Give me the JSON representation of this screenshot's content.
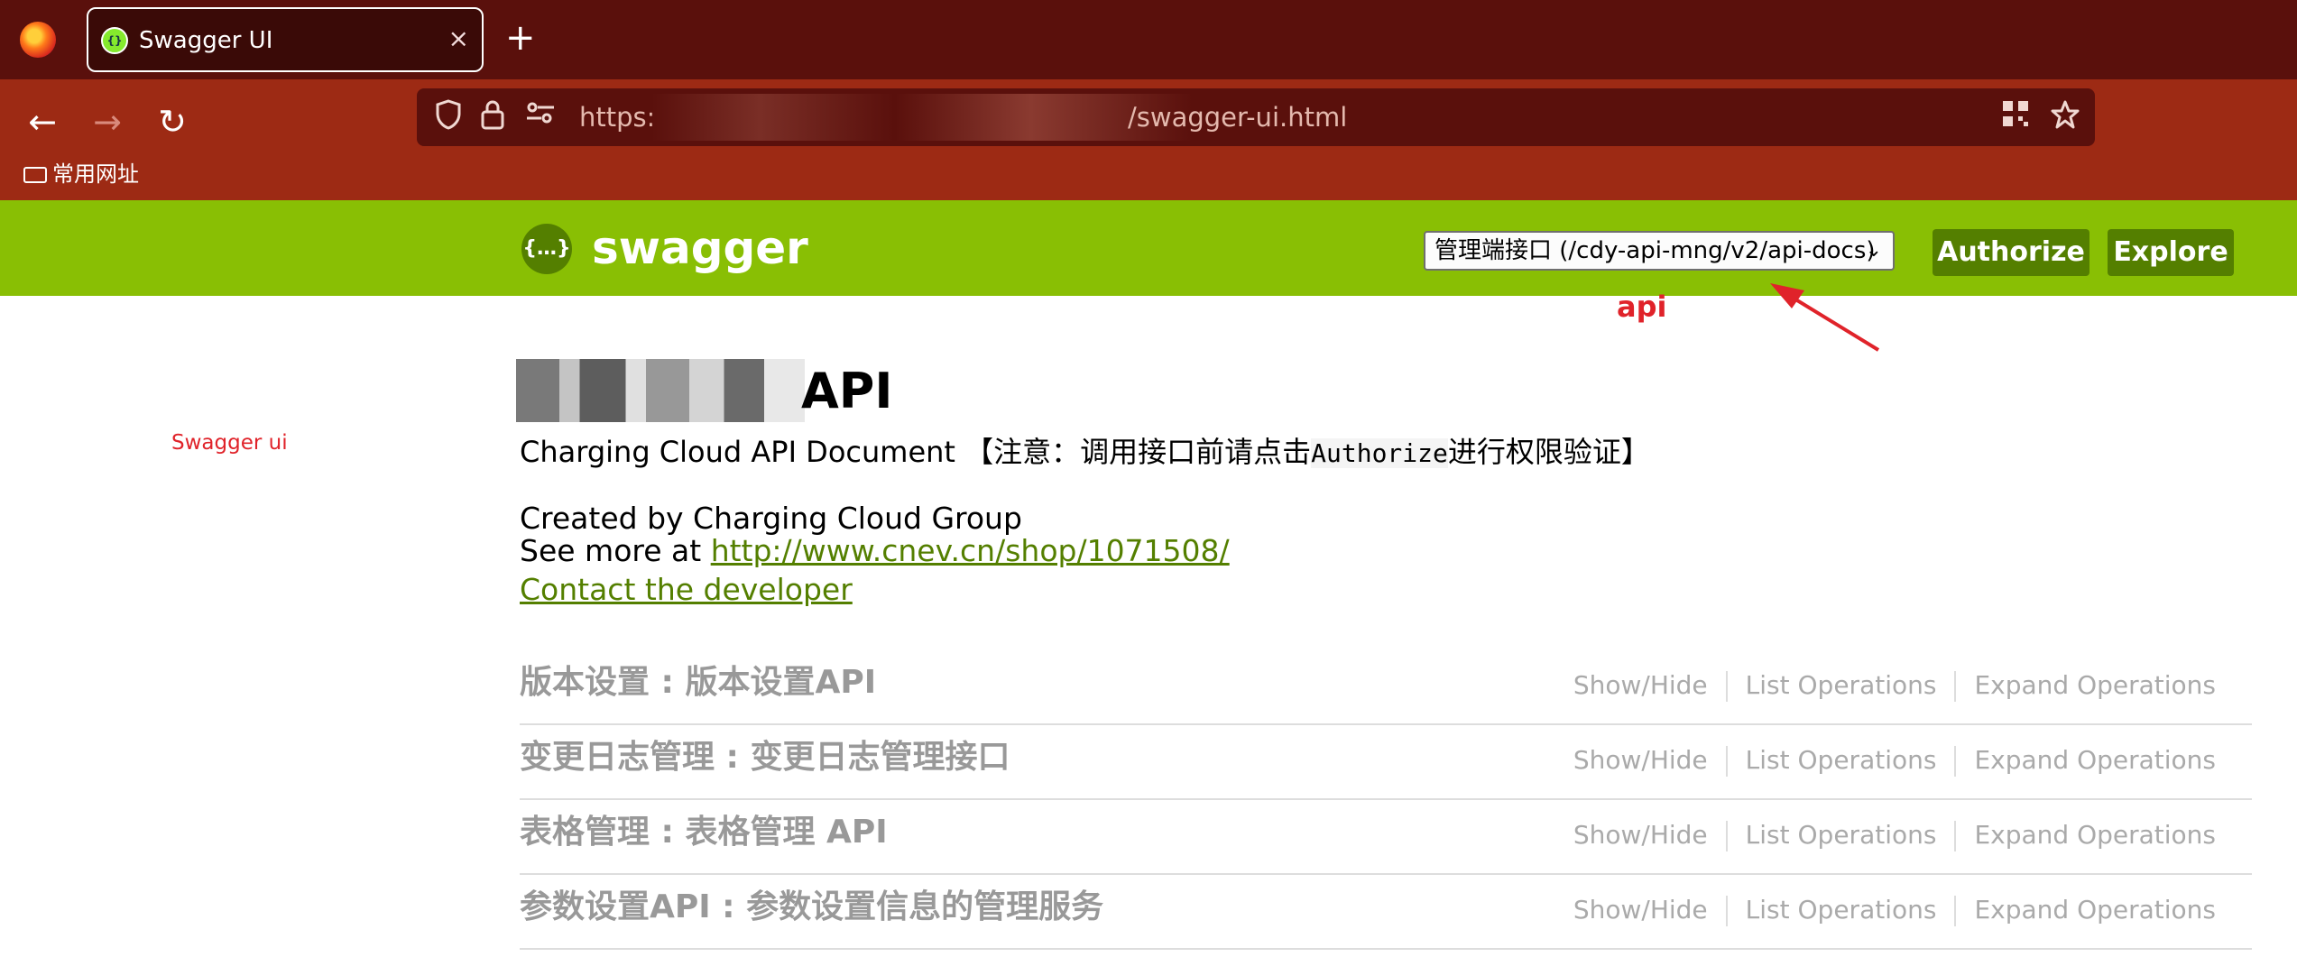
{
  "browser": {
    "tab_title": "Swagger UI",
    "tab_close": "×",
    "new_tab": "+",
    "url": "https://swagger-ui.html",
    "url_visible_tail": "/swagger-ui.html",
    "url_visible_head": "https:",
    "nav": {
      "back": "←",
      "forward": "→",
      "reload": "↻"
    },
    "bookmark": "常用网址"
  },
  "swagger": {
    "brand": "swagger",
    "logo_glyph": "{…}",
    "api_select_value": "管理端接口 (/cdy-api-mng/v2/api-docs)",
    "authorize_label": "Authorize",
    "explore_label": "Explore"
  },
  "annotations": {
    "api_label": "api",
    "left_label": "Swagger ui",
    "color": "#e0232a"
  },
  "info": {
    "title_suffix": "API",
    "description_prefix": "Charging Cloud API Document 【注意：调用接口前请点击",
    "description_code": "Authorize",
    "description_suffix": "进行权限验证】",
    "created_by": "Created by Charging Cloud Group",
    "see_more_prefix": "See more at",
    "see_more_link": "http://www.cnev.cn/shop/1071508/",
    "contact": "Contact the developer"
  },
  "resources": [
    {
      "name": "版本设置 : 版本设置API"
    },
    {
      "name": "变更日志管理 : 变更日志管理接口"
    },
    {
      "name": "表格管理 : 表格管理 API"
    },
    {
      "name": "参数设置API : 参数设置信息的管理服务"
    }
  ],
  "resource_ops": {
    "show_hide": "Show/Hide",
    "list": "List Operations",
    "expand": "Expand Operations"
  },
  "colors": {
    "swagger_green": "#89bf04",
    "button_green": "#547f00",
    "chrome_dark": "#5a100c",
    "chrome_red": "#9d2a14"
  }
}
